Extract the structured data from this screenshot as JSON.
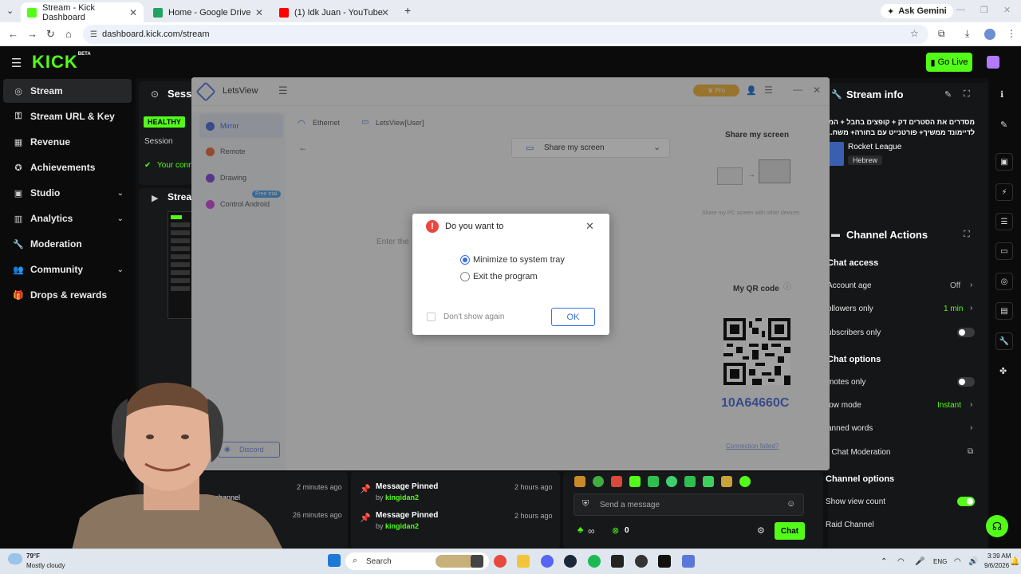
{
  "browser": {
    "tabs": [
      {
        "title": "Stream - Kick Dashboard",
        "favicon_color": "#53fc18"
      },
      {
        "title": "Home - Google Drive",
        "favicon_color": "#1fa463"
      },
      {
        "title": "(1) Idk Juan - YouTube",
        "favicon_color": "#ff0000"
      }
    ],
    "new_tab": "+",
    "ask_gemini": "Ask Gemini",
    "url": "dashboard.kick.com/stream"
  },
  "kick": {
    "logo": "KICK",
    "logo_badge": "BETA",
    "go_live": "Go Live",
    "sidebar": [
      {
        "label": "Stream",
        "icon": "stream-icon",
        "glyph": "◎"
      },
      {
        "label": "Stream URL & Key",
        "icon": "key-icon",
        "glyph": "⚿"
      },
      {
        "label": "Revenue",
        "icon": "revenue-icon",
        "glyph": "▦"
      },
      {
        "label": "Achievements",
        "icon": "trophy-icon",
        "glyph": "✪"
      },
      {
        "label": "Studio",
        "icon": "studio-icon",
        "glyph": "▣",
        "chevron": "⌄"
      },
      {
        "label": "Analytics",
        "icon": "analytics-icon",
        "glyph": "▥",
        "chevron": "⌄"
      },
      {
        "label": "Moderation",
        "icon": "wrench-icon",
        "glyph": "🔧"
      },
      {
        "label": "Community",
        "icon": "community-icon",
        "glyph": "👥",
        "chevron": "⌄"
      },
      {
        "label": "Drops & rewards",
        "icon": "gift-icon",
        "glyph": "🎁"
      }
    ],
    "session": {
      "title": "Sessi",
      "badge": "HEALTHY",
      "subtitle": "Session",
      "connection": "Your conn"
    },
    "stream_preview_title": "Strea",
    "stream_info": {
      "title": "Stream info",
      "stream_title_line1": "מסדרים את הסטרים דק + קופצים בחבל + המס",
      "stream_title_line2": "לדיימונד ממשיך+ פורטנייט עם בחורה+ משח...",
      "category": "Rocket League",
      "tag": "Hebrew"
    },
    "channel_actions": {
      "title": "Channel Actions",
      "chat_access": "Chat access",
      "account_age": "Account age",
      "account_age_value": "Off",
      "followers_only": "ollowers only",
      "followers_only_value": "1 min",
      "subscribers_only": "ubscribers only",
      "chat_options": "Chat options",
      "emotes_only": "motes only",
      "slow_mode": "low mode",
      "slow_mode_value": "Instant",
      "banned_words": "anned words",
      "ai_moderation": "I Chat Moderation",
      "channel_options": "Channel options",
      "show_view_count": "Show view count",
      "raid_channel": "Raid Channel"
    },
    "feed_left": [
      {
        "text": "ed the channel",
        "ago": "2 minutes ago"
      },
      {
        "text": "",
        "ago": "26 minutes ago"
      }
    ],
    "feed_mid": [
      {
        "title": "Message Pinned",
        "by": "by ",
        "user": "kingidan2",
        "ago": "2 hours ago"
      },
      {
        "title": "Message Pinned",
        "by": "by ",
        "user": "kingidan2",
        "ago": "2 hours ago"
      }
    ],
    "chat": {
      "placeholder": "Send a message",
      "viewers": "0",
      "send": "Chat"
    }
  },
  "letsview": {
    "app_name": "LetsView",
    "pro": "Pro",
    "nav": [
      {
        "label": "Mirror",
        "color": "#4a6bd8"
      },
      {
        "label": "Remote",
        "color": "#e86a3a"
      },
      {
        "label": "Drawing",
        "color": "#7a4ad8"
      },
      {
        "label": "Control Android",
        "color": "#c84ad8"
      }
    ],
    "free_trial": "Free trial",
    "conn_tabs": [
      "Ethernet",
      "LetsView[User]"
    ],
    "share_select": "Share my screen",
    "enter_code": "Enter the",
    "share_heading": "Share my screen",
    "share_sub": "Share my PC screen with other devices",
    "qr_heading": "My QR code",
    "code": "10A64660C",
    "connection_failed": "Connection failed?",
    "discord": "Discord"
  },
  "dialog": {
    "title": "Do you want to",
    "option1": "Minimize to system tray",
    "option2": "Exit the program",
    "dont_show": "Don't show again",
    "ok": "OK"
  },
  "taskbar": {
    "weather_temp": "79°F",
    "weather_desc": "Mostly cloudy",
    "search": "Search",
    "lang": "ENG",
    "time": "3:39 AM",
    "date": "9/6/2026"
  }
}
